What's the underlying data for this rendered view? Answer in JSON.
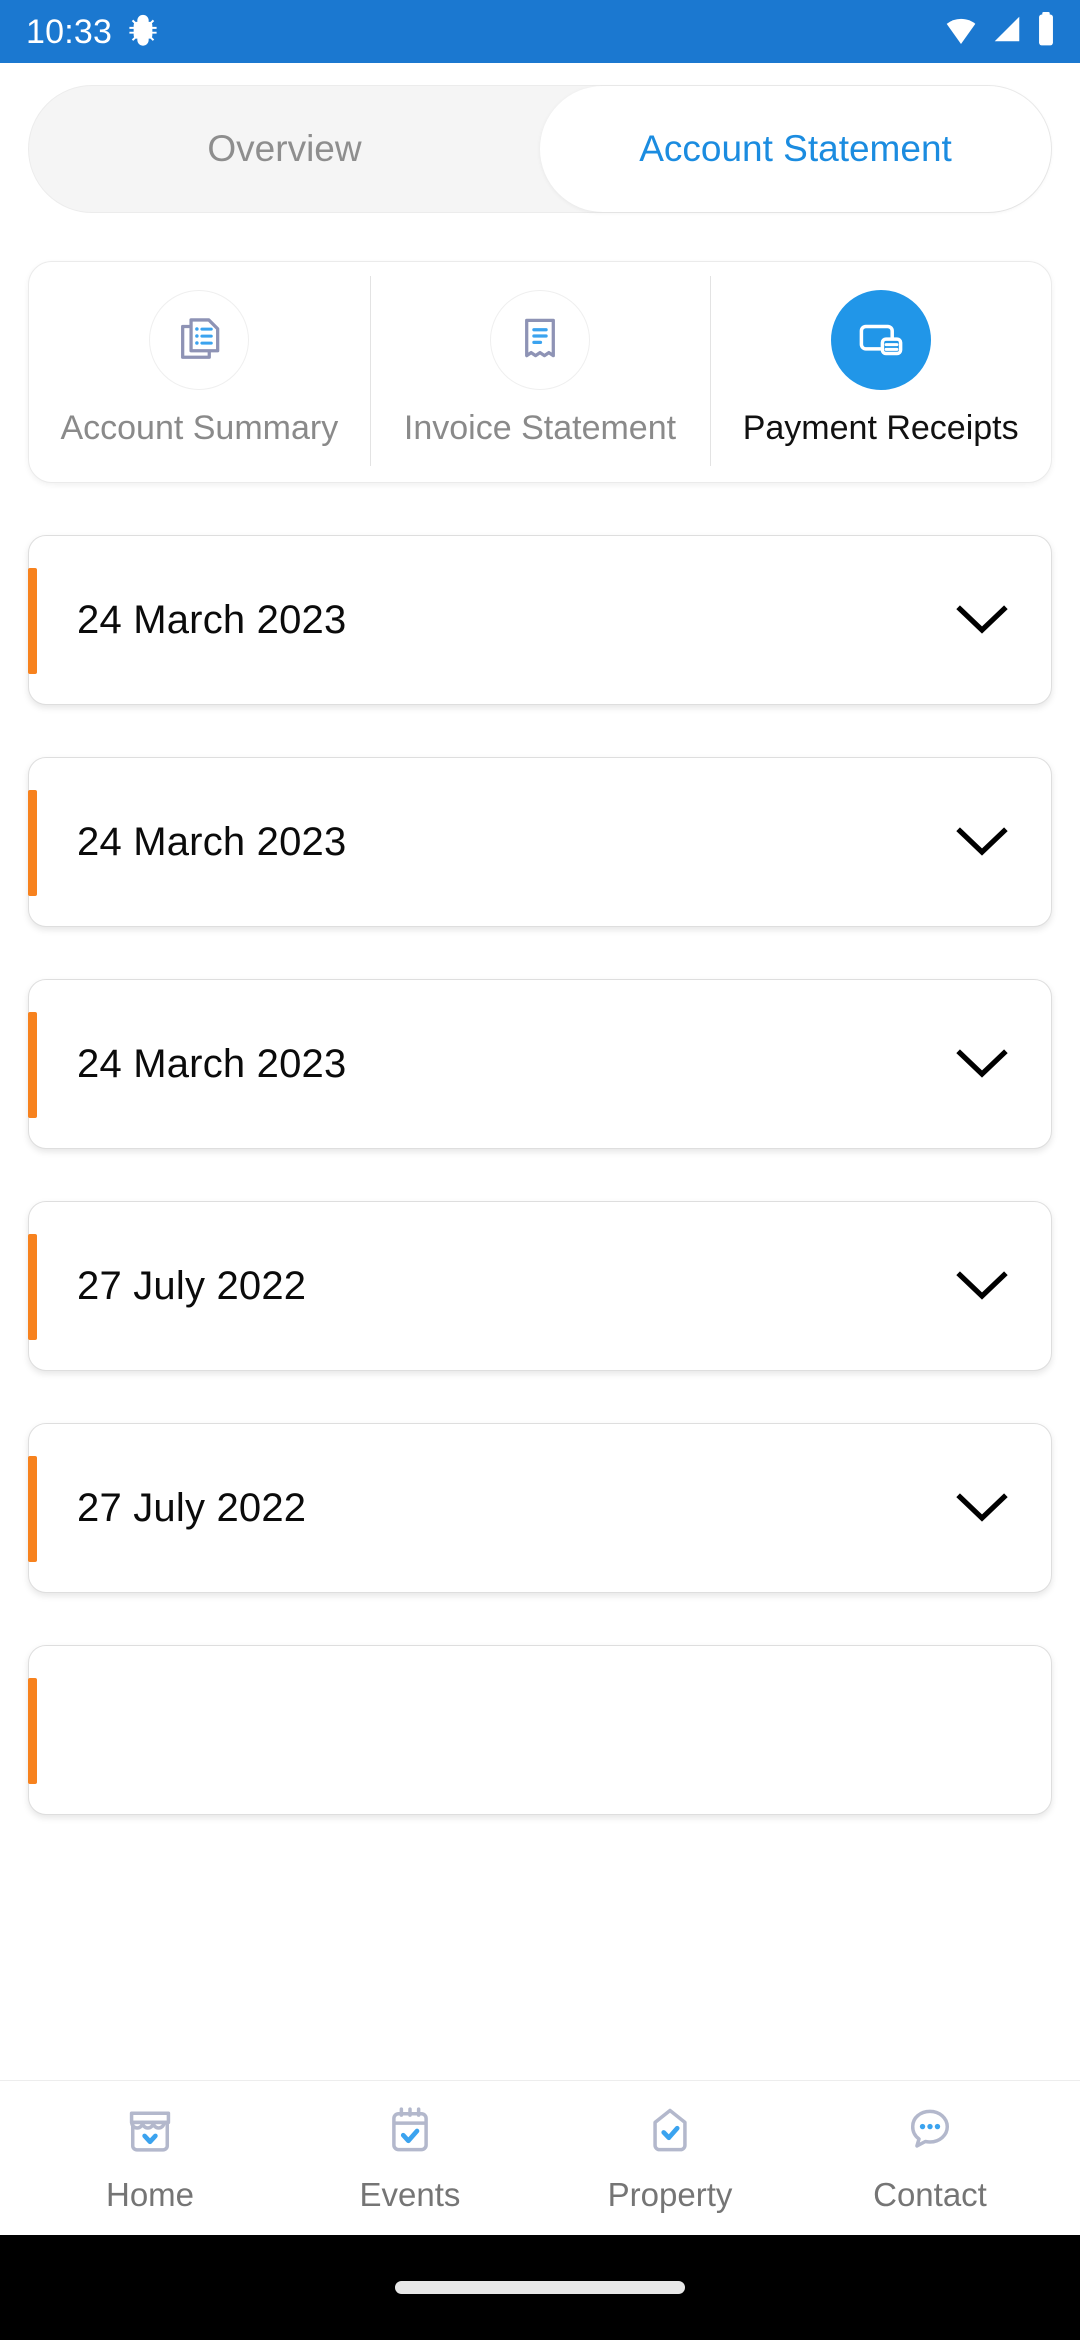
{
  "status_bar": {
    "time": "10:33",
    "left_icon": "bug-icon",
    "right_icons": [
      "wifi-icon",
      "cellular-signal-icon",
      "battery-icon"
    ]
  },
  "tabs": {
    "items": [
      {
        "label": "Overview",
        "active": false
      },
      {
        "label": "Account Statement",
        "active": true
      }
    ],
    "active_color": "#1b8ce0",
    "inactive_color": "#8e8e8e"
  },
  "statement_types": {
    "items": [
      {
        "label": "Account Summary",
        "icon": "stacked-documents-icon",
        "active": false
      },
      {
        "label": "Invoice Statement",
        "icon": "receipt-icon",
        "active": false
      },
      {
        "label": "Payment Receipts",
        "icon": "payment-card-icon",
        "active": true
      }
    ],
    "active_bg": "#2196e8"
  },
  "receipts": {
    "accent_color": "#f7821e",
    "chevron_icon": "chevron-down-icon",
    "rows": [
      {
        "date": "24 March 2023"
      },
      {
        "date": "24 March 2023"
      },
      {
        "date": "24 March 2023"
      },
      {
        "date": "27 July 2022"
      },
      {
        "date": "27 July 2022"
      },
      {
        "date": ""
      }
    ]
  },
  "bottom_nav": {
    "items": [
      {
        "label": "Home",
        "icon": "storefront-icon"
      },
      {
        "label": "Events",
        "icon": "calendar-check-icon"
      },
      {
        "label": "Property",
        "icon": "shield-check-icon"
      },
      {
        "label": "Contact",
        "icon": "chat-dots-icon"
      }
    ]
  },
  "colors": {
    "status_bar": "#1b78d0",
    "accent_blue": "#2196e8",
    "accent_orange": "#f7821e"
  }
}
